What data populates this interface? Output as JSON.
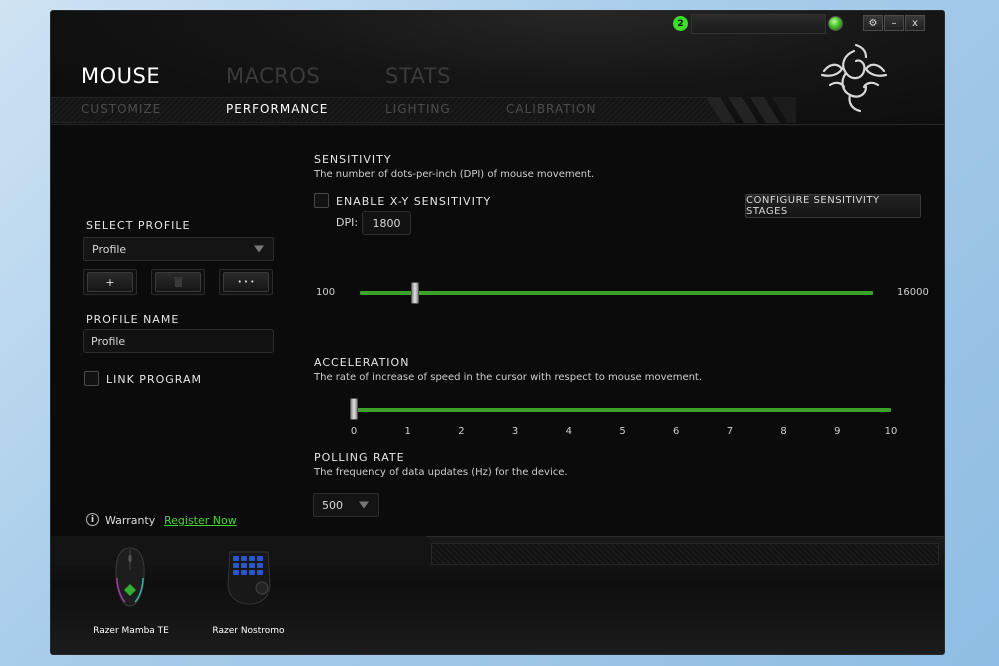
{
  "titlebar": {
    "notification_count": "2",
    "window_buttons": {
      "settings_icon": "gear-icon",
      "minimize_label": "–",
      "close_label": "x"
    }
  },
  "main_tabs": [
    {
      "label": "MOUSE",
      "active": true
    },
    {
      "label": "MACROS",
      "active": false
    },
    {
      "label": "STATS",
      "active": false
    }
  ],
  "sub_tabs": [
    {
      "label": "CUSTOMIZE",
      "active": false
    },
    {
      "label": "PERFORMANCE",
      "active": true
    },
    {
      "label": "LIGHTING",
      "active": false
    },
    {
      "label": "CALIBRATION",
      "active": false
    }
  ],
  "profile": {
    "select_label": "SELECT PROFILE",
    "selected_value": "Profile",
    "add_button": "+",
    "delete_icon": "trash-icon",
    "more_button": "• • •",
    "name_label": "PROFILE NAME",
    "name_value": "Profile",
    "link_program_label": "LINK PROGRAM"
  },
  "sensitivity": {
    "title": "SENSITIVITY",
    "description": "The number of dots-per-inch (DPI) of mouse movement.",
    "enable_xy_label": "ENABLE X-Y SENSITIVITY",
    "dpi_label": "DPI:",
    "dpi_value": "1800",
    "configure_button": "CONFIGURE SENSITIVITY STAGES",
    "min_label": "100",
    "max_label": "16000",
    "min": 100,
    "max": 16000,
    "value": 1800
  },
  "acceleration": {
    "title": "ACCELERATION",
    "description": "The rate of increase of speed in the cursor with respect to mouse movement.",
    "ticks": [
      "0",
      "1",
      "2",
      "3",
      "4",
      "5",
      "6",
      "7",
      "8",
      "9",
      "10"
    ],
    "min": 0,
    "max": 10,
    "value": 0
  },
  "polling": {
    "title": "POLLING RATE",
    "description": "The frequency of data updates (Hz) for the device.",
    "selected_value": "500"
  },
  "warranty": {
    "label": "Warranty",
    "link": "Register Now"
  },
  "devices": [
    {
      "name": "Razer Mamba TE"
    },
    {
      "name": "Razer Nostromo"
    }
  ],
  "colors": {
    "accent_green": "#44d62c",
    "background": "#0b0b0b"
  }
}
